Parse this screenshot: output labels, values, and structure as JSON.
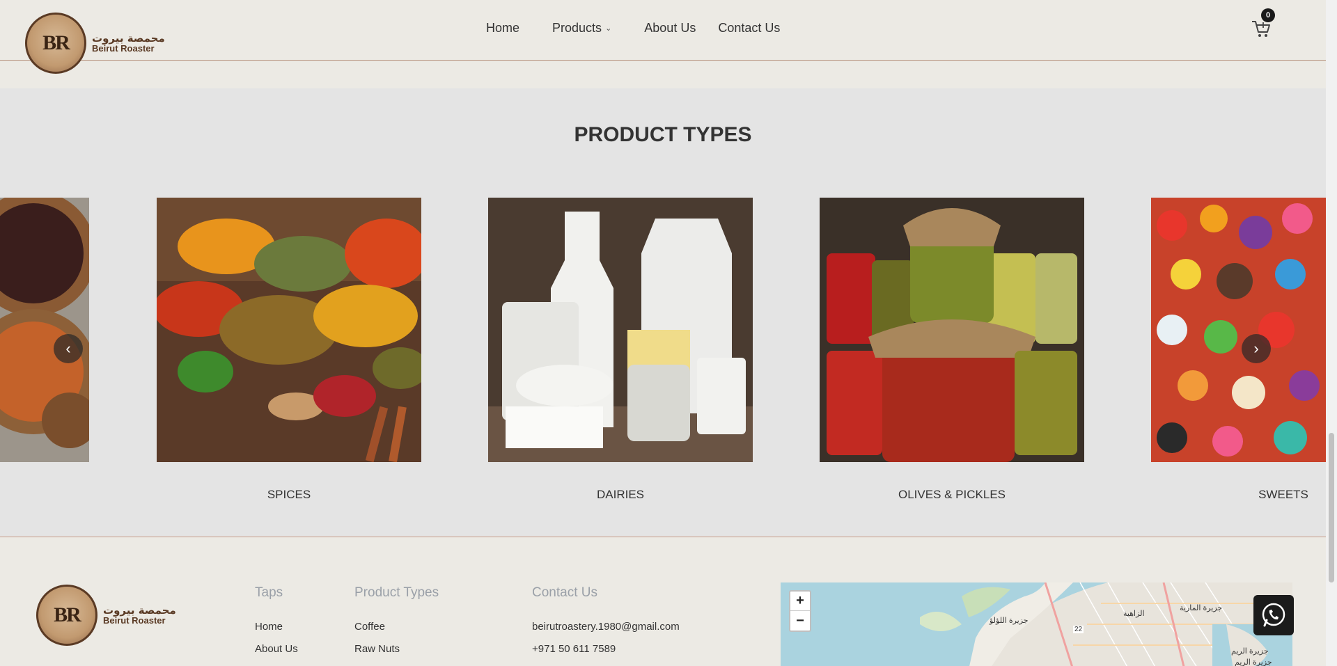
{
  "brand": {
    "name_ar": "محمصة بيروت",
    "name_en": "Beirut Roaster",
    "logo_letters": "BR"
  },
  "nav": {
    "home": "Home",
    "products": "Products",
    "about": "About Us",
    "contact": "Contact Us"
  },
  "cart": {
    "count": "0",
    "icon": "cart-icon"
  },
  "product_types": {
    "title": "PRODUCT TYPES",
    "cards": [
      {
        "label": "",
        "image": "coffee-beans-image"
      },
      {
        "label": "SPICES",
        "image": "spices-image"
      },
      {
        "label": "DAIRIES",
        "image": "dairies-image"
      },
      {
        "label": "OLIVES & PICKLES",
        "image": "olives-pickles-image"
      },
      {
        "label": "SWEETS",
        "image": "sweets-image"
      }
    ],
    "prev_icon": "chevron-left-icon",
    "next_icon": "chevron-right-icon"
  },
  "footer": {
    "taps": {
      "title": "Taps",
      "links": [
        "Home",
        "About Us"
      ]
    },
    "product_types": {
      "title": "Product Types",
      "links": [
        "Coffee",
        "Raw Nuts"
      ]
    },
    "contact": {
      "title": "Contact Us",
      "email": "beirutroastery.1980@gmail.com",
      "phone": "+971 50 611 7589"
    },
    "map": {
      "zoom_in": "+",
      "zoom_out": "−",
      "labels": [
        "جزيرة اللؤلؤ",
        "الزاهية",
        "جزيرة المارية",
        "جزيرة الريم",
        "جزيرة الريم",
        "22"
      ]
    }
  },
  "colors": {
    "background": "#eceae4",
    "section_bg": "#e4e4e4",
    "accent_border": "#b5907a",
    "footer_heading": "#9aa0a8"
  }
}
